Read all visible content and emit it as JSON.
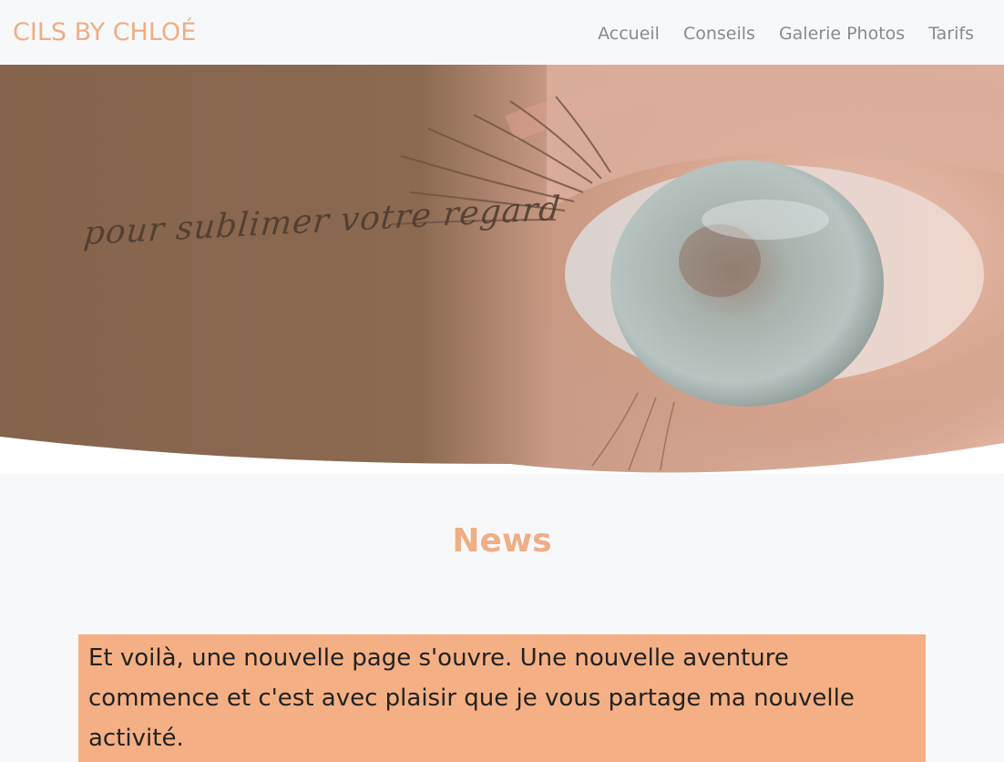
{
  "navbar": {
    "brand": "CILS BY CHLOÉ",
    "links": [
      {
        "label": "Accueil"
      },
      {
        "label": "Conseils"
      },
      {
        "label": "Galerie Photos"
      },
      {
        "label": "Tarifs"
      }
    ]
  },
  "hero": {
    "tagline": "pour sublimer votre regard",
    "image": "eye-closeup-photo"
  },
  "news": {
    "title": "News",
    "text": "Et voilà, une nouvelle page s'ouvre. Une nouvelle aventure commence et c'est avec plaisir que je vous partage ma nouvelle activité."
  },
  "colors": {
    "brand": "#eeae85",
    "nav_link": "#8a8a8a",
    "card_bg": "#f4b084",
    "page_bg": "#f7f8fa"
  }
}
